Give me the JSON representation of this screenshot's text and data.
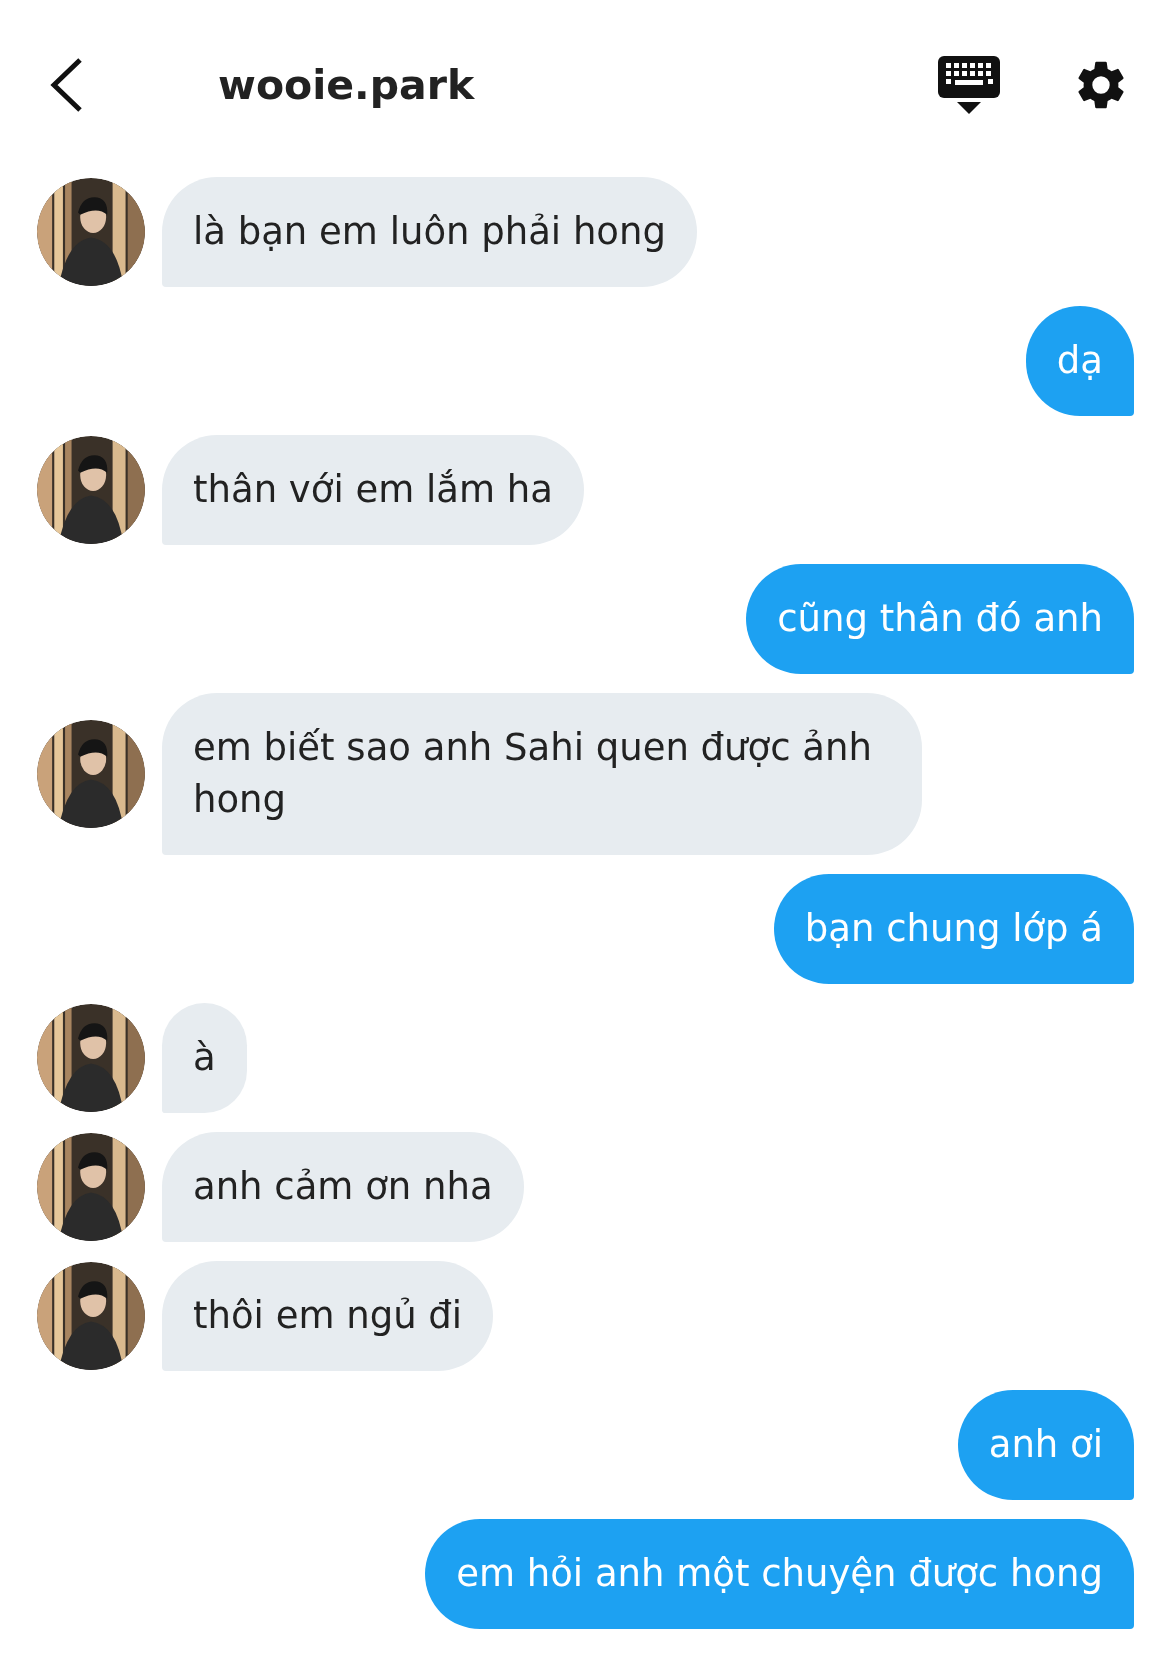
{
  "header": {
    "title": "wooie.park"
  },
  "messages": [
    {
      "kind": "incoming",
      "text": "là bạn em luôn phải hong"
    },
    {
      "kind": "outgoing",
      "text": "dạ"
    },
    {
      "kind": "incoming",
      "text": "thân với em lắm ha"
    },
    {
      "kind": "outgoing",
      "text": "cũng thân đó anh"
    },
    {
      "kind": "incoming",
      "text": "em biết sao anh Sahi quen được ảnh hong"
    },
    {
      "kind": "outgoing",
      "text": "bạn chung lớp á"
    },
    {
      "kind": "incoming",
      "text": "à"
    },
    {
      "kind": "incoming",
      "text": "anh cảm ơn nha"
    },
    {
      "kind": "incoming",
      "text": "thôi em ngủ đi"
    },
    {
      "kind": "outgoing",
      "text": "anh ơi"
    },
    {
      "kind": "outgoing",
      "text": "em hỏi anh một chuyện được hong"
    }
  ]
}
